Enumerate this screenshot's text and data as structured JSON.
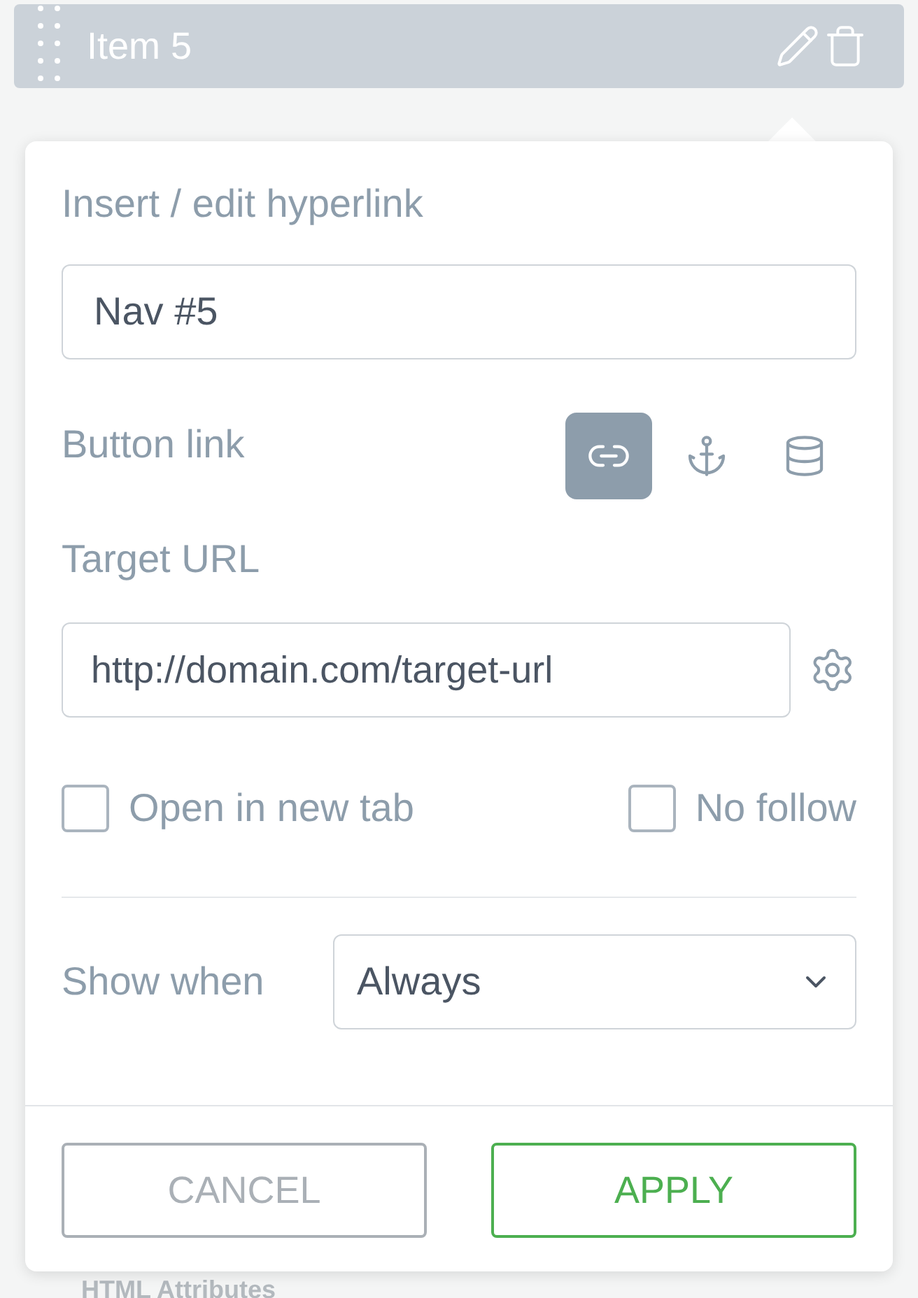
{
  "item": {
    "title": "Item 5"
  },
  "popup": {
    "title": "Insert / edit hyperlink",
    "text_value": "Nav #5",
    "link_label": "Button link",
    "link_types": [
      {
        "kind": "link",
        "selected": true
      },
      {
        "kind": "anchor",
        "selected": false
      },
      {
        "kind": "data",
        "selected": false
      }
    ],
    "url_label": "Target URL",
    "url_value": "http://domain.com/target-url",
    "options": [
      {
        "label": "Open in new tab",
        "checked": false
      },
      {
        "label": "No follow",
        "checked": false
      }
    ],
    "show_when_label": "Show when",
    "show_when_value": "Always",
    "buttons": [
      {
        "kind": "cancel",
        "label": "CANCEL"
      },
      {
        "kind": "apply",
        "label": "APPLY"
      }
    ]
  },
  "next_section": {
    "title": "HTML Attributes"
  }
}
